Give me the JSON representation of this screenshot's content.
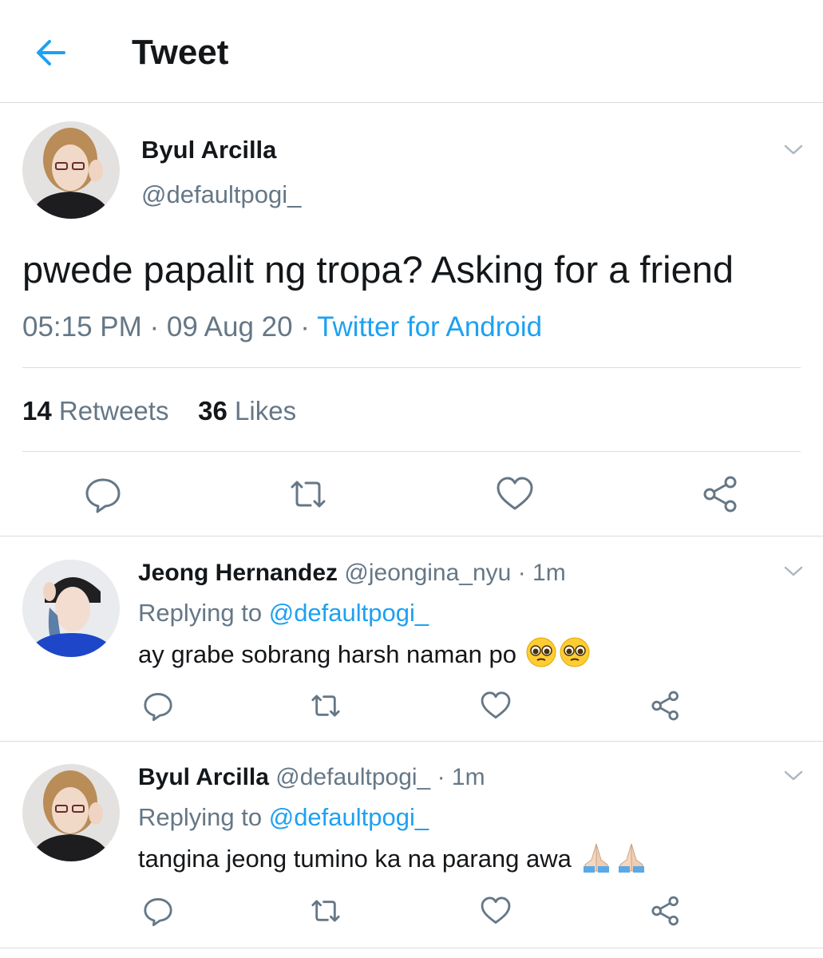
{
  "header": {
    "title": "Tweet"
  },
  "tweet": {
    "name": "Byul Arcilla",
    "handle": "@defaultpogi_",
    "text": "pwede papalit ng tropa? Asking for a friend",
    "time": "05:15 PM",
    "date": "09 Aug 20",
    "separator": " · ",
    "source": "Twitter for Android",
    "retweets": "14",
    "retweets_label": "Retweets",
    "likes": "36",
    "likes_label": "Likes"
  },
  "replies": [
    {
      "name": "Jeong Hernandez",
      "handle": "@jeongina_nyu",
      "time": "1m",
      "replying_label": "Replying to",
      "replying_to": "@defaultpogi_",
      "text": "ay grabe sobrang harsh naman po",
      "emoji": "pleading-face"
    },
    {
      "name": "Byul Arcilla",
      "handle": "@defaultpogi_",
      "time": "1m",
      "replying_label": "Replying to",
      "replying_to": "@defaultpogi_",
      "text": "tangina jeong tumino ka na parang awa",
      "emoji": "folded-hands"
    }
  ],
  "colors": {
    "accent": "#1da1f2",
    "secondary": "#657786",
    "divider": "#d8dde1",
    "text": "#14171a"
  },
  "icons": [
    "back-arrow-icon",
    "chevron-down-icon",
    "reply-icon",
    "retweet-icon",
    "like-icon",
    "share-icon"
  ]
}
